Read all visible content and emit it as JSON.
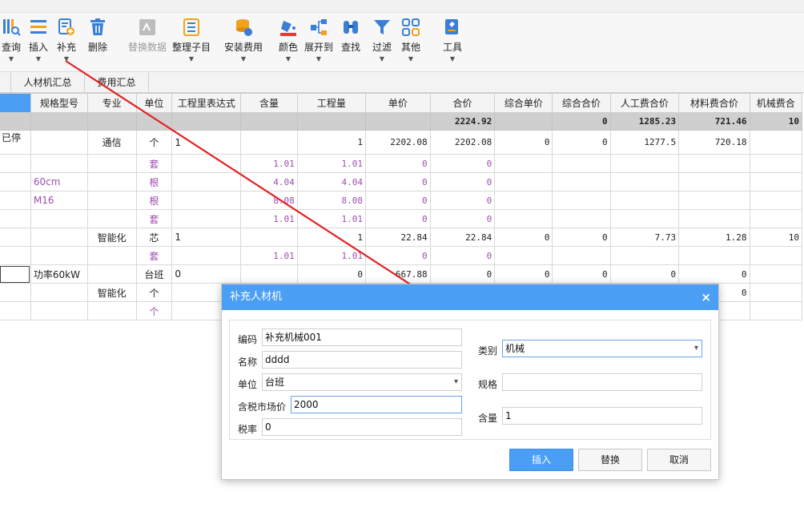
{
  "toolbar": {
    "items": [
      {
        "label": "查询",
        "icon": "query-icon",
        "caret": true,
        "disabled": false
      },
      {
        "label": "插入",
        "icon": "insert-icon",
        "caret": true,
        "disabled": false
      },
      {
        "label": "补充",
        "icon": "supplement-icon",
        "caret": true,
        "disabled": false
      },
      {
        "label": "删除",
        "icon": "delete-icon",
        "caret": false,
        "disabled": false
      },
      {
        "label": "替换数据",
        "icon": "replace-data-icon",
        "caret": false,
        "disabled": true
      },
      {
        "label": "整理子目",
        "icon": "organize-icon",
        "caret": true,
        "disabled": false
      },
      {
        "label": "安装费用",
        "icon": "install-cost-icon",
        "caret": true,
        "disabled": false
      },
      {
        "label": "颜色",
        "icon": "color-icon",
        "caret": true,
        "disabled": false
      },
      {
        "label": "展开到",
        "icon": "expand-icon",
        "caret": true,
        "disabled": false
      },
      {
        "label": "查找",
        "icon": "find-icon",
        "caret": false,
        "disabled": false
      },
      {
        "label": "过滤",
        "icon": "filter-icon",
        "caret": true,
        "disabled": false
      },
      {
        "label": "其他",
        "icon": "more-icon",
        "caret": true,
        "disabled": false
      },
      {
        "label": "工具",
        "icon": "tools-icon",
        "caret": true,
        "disabled": false
      }
    ]
  },
  "tabs": [
    "人材机汇总",
    "费用汇总"
  ],
  "grid": {
    "headers": [
      "",
      "规格型号",
      "专业",
      "单位",
      "工程里表达式",
      "含量",
      "工程量",
      "单价",
      "合价",
      "综合单价",
      "综合合价",
      "人工费合价",
      "材料费合价",
      "机械费合"
    ],
    "summary": [
      "",
      "",
      "",
      "",
      "",
      "",
      "",
      "",
      "2224.92",
      "",
      "0",
      "1285.23",
      "721.46",
      "10"
    ],
    "rows": [
      {
        "cells": [
          "已停",
          "",
          "通信",
          "个",
          "1",
          "",
          "1",
          "2202.08",
          "2202.08",
          "0",
          "0",
          "1277.5",
          "720.18",
          ""
        ],
        "purple": false,
        "tall": true
      },
      {
        "cells": [
          "",
          "",
          "",
          "套",
          "",
          "1.01",
          "1.01",
          "0",
          "0",
          "",
          "",
          "",
          "",
          ""
        ],
        "purple": true,
        "tall": false
      },
      {
        "cells": [
          "",
          "60cm",
          "",
          "根",
          "",
          "4.04",
          "4.04",
          "0",
          "0",
          "",
          "",
          "",
          "",
          ""
        ],
        "purple": true,
        "tall": false
      },
      {
        "cells": [
          "",
          "M16",
          "",
          "根",
          "",
          "8.08",
          "8.08",
          "0",
          "0",
          "",
          "",
          "",
          "",
          ""
        ],
        "purple": true,
        "tall": false
      },
      {
        "cells": [
          "",
          "",
          "",
          "套",
          "",
          "1.01",
          "1.01",
          "0",
          "0",
          "",
          "",
          "",
          "",
          ""
        ],
        "purple": true,
        "tall": false
      },
      {
        "cells": [
          "",
          "",
          "智能化",
          "芯",
          "1",
          "",
          "1",
          "22.84",
          "22.84",
          "0",
          "0",
          "7.73",
          "1.28",
          "10"
        ],
        "purple": false,
        "tall": false
      },
      {
        "cells": [
          "",
          "",
          "",
          "套",
          "",
          "1.01",
          "1.01",
          "0",
          "0",
          "",
          "",
          "",
          "",
          ""
        ],
        "purple": true,
        "tall": false
      },
      {
        "cells": [
          "",
          "功率60kW",
          "",
          "台班",
          "0",
          "",
          "0",
          "667.88",
          "0",
          "0",
          "0",
          "0",
          "0",
          ""
        ],
        "purple": false,
        "tall": false
      },
      {
        "cells": [
          "",
          "",
          "智能化",
          "个",
          "",
          "",
          "",
          "",
          "",
          "",
          "",
          "",
          "0",
          ""
        ],
        "purple": false,
        "tall": false
      },
      {
        "cells": [
          "",
          "",
          "",
          "个",
          "",
          "",
          "",
          "",
          "",
          "",
          "",
          "",
          "",
          ""
        ],
        "purple": true,
        "tall": false
      }
    ]
  },
  "dialog": {
    "title": "补充人材机",
    "close": "×",
    "code_label": "编码",
    "code_value": "补充机械001",
    "name_label": "名称",
    "name_value": "dddd",
    "unit_label": "单位",
    "unit_value": "台班",
    "price_label": "含税市场价",
    "price_value": "2000",
    "tax_label": "税率",
    "tax_value": "0",
    "category_label": "类别",
    "category_value": "机械",
    "spec_label": "规格",
    "spec_value": "",
    "qty_label": "含量",
    "qty_value": "1",
    "insert_button": "插入",
    "replace_button": "替换",
    "cancel_button": "取消"
  },
  "colors": {
    "accent": "#4a9ff5",
    "purple_text": "#a04cb0",
    "arrow": "#e32222",
    "summary_bg": "#cfcfcf"
  }
}
